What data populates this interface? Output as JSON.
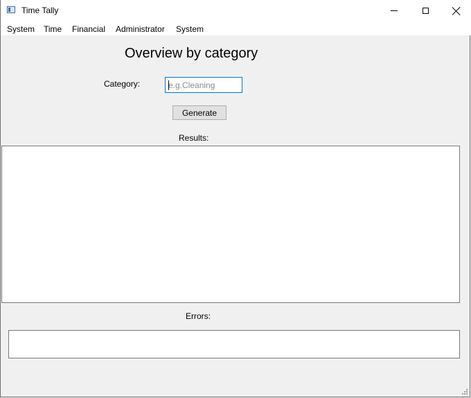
{
  "window": {
    "title": "Time Tally",
    "icons": {
      "app": "app-window-icon",
      "minimize": "minimize-icon",
      "maximize": "maximize-icon",
      "close": "close-icon",
      "resize": "resize-grip-icon"
    }
  },
  "menu": {
    "items": [
      {
        "label": "System"
      },
      {
        "label": "Time"
      },
      {
        "label": "Financial"
      },
      {
        "label": "Administrator"
      },
      {
        "label": "System"
      }
    ]
  },
  "main": {
    "title": "Overview by category",
    "category_label": "Category:",
    "category_input": {
      "value": "",
      "placeholder": "e.g.Cleaning"
    },
    "generate_label": "Generate",
    "results_label": "Results:",
    "results_text": "",
    "errors_label": "Errors:",
    "errors_text": ""
  },
  "colors": {
    "client_background": "#f0f0f0",
    "titlebar_background": "#ffffff",
    "input_focus_border": "#0078d7",
    "button_background": "#e1e1e1",
    "box_border": "#7a7a7a"
  }
}
